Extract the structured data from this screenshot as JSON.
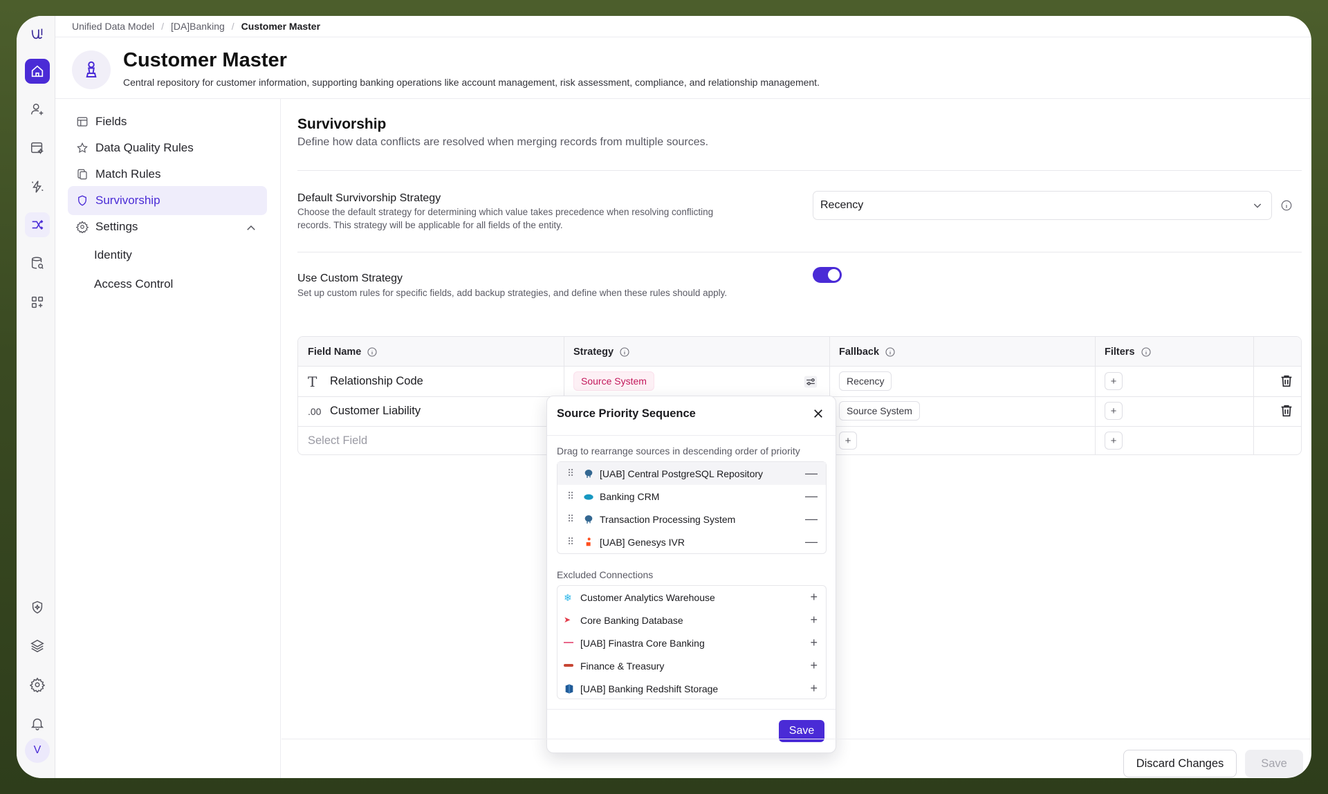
{
  "breadcrumb": [
    "Unified Data Model",
    "[DA]Banking",
    "Customer Master"
  ],
  "header": {
    "title": "Customer Master",
    "description": "Central repository for customer information, supporting banking operations like account management, risk assessment, compliance, and relationship management."
  },
  "user": {
    "initial": "V"
  },
  "nav": {
    "items": [
      {
        "label": "Fields",
        "icon": "table-icon"
      },
      {
        "label": "Data Quality Rules",
        "icon": "star-icon"
      },
      {
        "label": "Match Rules",
        "icon": "copy-icon"
      },
      {
        "label": "Survivorship",
        "icon": "shield-icon"
      },
      {
        "label": "Settings",
        "icon": "gear-icon"
      }
    ],
    "settings_sub": [
      "Identity",
      "Access Control"
    ]
  },
  "section": {
    "title": "Survivorship",
    "description": "Define how data conflicts are resolved when merging records from multiple sources."
  },
  "default_strategy": {
    "label": "Default Survivorship Strategy",
    "desc_line1": "Choose the default strategy for determining which value takes precedence when resolving conflicting",
    "desc_line2": "records. This strategy will be applicable for all fields of the entity.",
    "value": "Recency"
  },
  "custom_strategy": {
    "label": "Use Custom Strategy",
    "desc": "Set up custom rules for specific fields, add backup strategies, and define when these rules should apply.",
    "enabled": true
  },
  "table": {
    "headers": [
      "Field Name",
      "Strategy",
      "Fallback",
      "Filters"
    ],
    "rows": [
      {
        "field": "Relationship Code",
        "field_icon": "T",
        "strategy": "Source System",
        "fallback": "Recency"
      },
      {
        "field": "Customer Liability",
        "field_icon": ".00",
        "strategy": "",
        "fallback": "Source System"
      }
    ],
    "new_row_placeholder": "Select Field"
  },
  "popover": {
    "title": "Source Priority Sequence",
    "instruction": "Drag to rearrange sources in descending order of priority",
    "priority": [
      {
        "name": "[UAB] Central PostgreSQL Repository",
        "icon": "postgres-icon"
      },
      {
        "name": "Banking CRM",
        "icon": "salesforce-icon"
      },
      {
        "name": "Transaction Processing System",
        "icon": "postgres-icon"
      },
      {
        "name": "[UAB] Genesys IVR",
        "icon": "genesys-icon"
      }
    ],
    "excluded_label": "Excluded Connections",
    "excluded": [
      {
        "name": "Customer Analytics Warehouse",
        "icon": "snowflake-icon"
      },
      {
        "name": "Core Banking Database",
        "icon": "arrow-icon"
      },
      {
        "name": "[UAB] Finastra Core Banking",
        "icon": "finastra-icon"
      },
      {
        "name": "Finance & Treasury",
        "icon": "oracle-icon"
      },
      {
        "name": "[UAB] Banking Redshift Storage",
        "icon": "redshift-icon"
      }
    ],
    "save_label": "Save"
  },
  "footer": {
    "discard_label": "Discard Changes",
    "save_label": "Save"
  },
  "colors": {
    "accent": "#4a2bd6",
    "pink": "#c2185b"
  }
}
